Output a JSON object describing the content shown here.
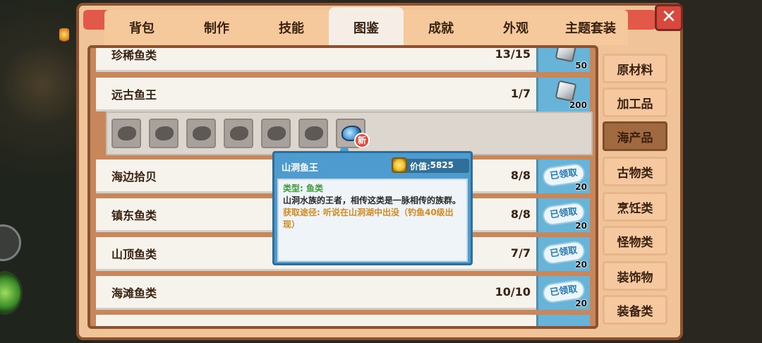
{
  "window": {
    "close_label": "✕"
  },
  "tabs": [
    {
      "label": "背包"
    },
    {
      "label": "制作"
    },
    {
      "label": "技能"
    },
    {
      "label": "图鉴"
    },
    {
      "label": "成就"
    },
    {
      "label": "外观"
    },
    {
      "label": "主题套装"
    }
  ],
  "active_tab": "图鉴",
  "categories": [
    {
      "label": "原材料"
    },
    {
      "label": "加工品"
    },
    {
      "label": "海产品"
    },
    {
      "label": "古物类"
    },
    {
      "label": "烹饪类"
    },
    {
      "label": "怪物类"
    },
    {
      "label": "装饰物"
    },
    {
      "label": "装备类"
    }
  ],
  "active_category": "海产品",
  "rows": [
    {
      "name": "珍稀鱼类",
      "count": "13/15",
      "reward": "50",
      "claimed": false
    },
    {
      "name": "远古鱼王",
      "count": "1/7",
      "reward": "200",
      "claimed": false
    },
    {
      "name": "海边拾贝",
      "count": "8/8",
      "reward": "20",
      "claimed": true,
      "claimed_label": "已领取"
    },
    {
      "name": "镇东鱼类",
      "count": "8/8",
      "reward": "20",
      "claimed": true,
      "claimed_label": "已领取"
    },
    {
      "name": "山顶鱼类",
      "count": "7/7",
      "reward": "20",
      "claimed": true,
      "claimed_label": "已领取"
    },
    {
      "name": "海滩鱼类",
      "count": "10/10",
      "reward": "20",
      "claimed": true,
      "claimed_label": "已领取"
    }
  ],
  "expanded_fish": {
    "slots_locked": 7,
    "slot_unlocked_badge": "新"
  },
  "tooltip": {
    "title": "山洞鱼王",
    "value_label": "价值:",
    "value": "5825",
    "type_line": "类型: 鱼类",
    "description": "山洞水族的王者，相传这类是一脉相传的族群。",
    "source": "获取途径: 听说在山洞湖中出没（钓鱼40级出现）"
  },
  "colors": {
    "panel_bg": "#f0c398",
    "tab_active_bg": "#f6eee6",
    "reward_blue": "#67b4d8",
    "category_active": "#a0693f",
    "type_green": "#3f9a3a",
    "source_orange": "#d38a20"
  },
  "icons": {
    "close": "close-icon",
    "coin": "coin-icon",
    "reward_stone": "stone-icon"
  }
}
